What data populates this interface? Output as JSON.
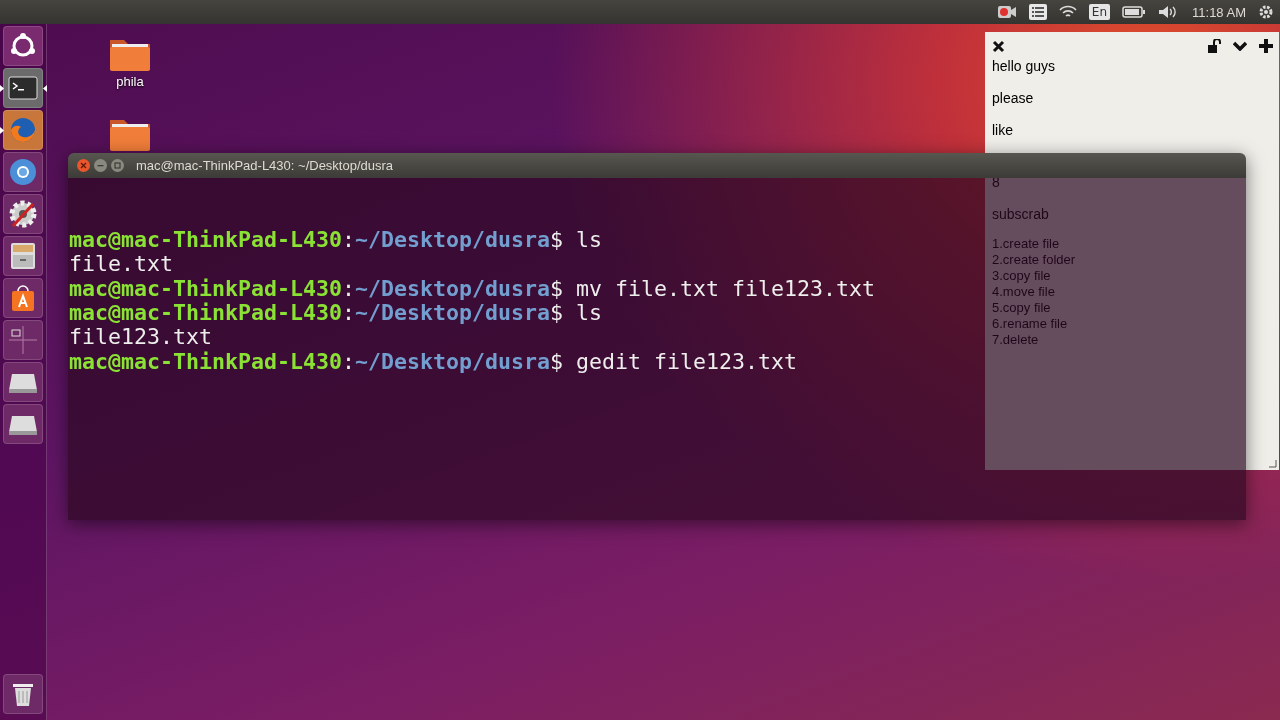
{
  "top_panel": {
    "indicators": [
      {
        "kind": "recorder"
      },
      {
        "kind": "menu"
      },
      {
        "kind": "wifi"
      },
      {
        "kind": "keyboard",
        "label": "En"
      },
      {
        "kind": "battery"
      },
      {
        "kind": "volume"
      }
    ],
    "clock": "11:18 AM"
  },
  "launcher": {
    "items": [
      {
        "kind": "dash",
        "running": false,
        "focused": false
      },
      {
        "kind": "terminal",
        "running": true,
        "focused": true
      },
      {
        "kind": "firefox",
        "running": true,
        "focused": false
      },
      {
        "kind": "chromium",
        "running": false,
        "focused": false
      },
      {
        "kind": "settings",
        "running": false,
        "focused": false
      },
      {
        "kind": "files",
        "running": false,
        "focused": false
      },
      {
        "kind": "software",
        "running": false,
        "focused": false
      },
      {
        "kind": "workspaces",
        "running": false,
        "focused": false
      },
      {
        "kind": "drive",
        "running": false,
        "focused": false
      },
      {
        "kind": "drive",
        "running": false,
        "focused": false
      }
    ],
    "trash": {
      "kind": "trash"
    }
  },
  "desktop_icons": [
    {
      "kind": "folder",
      "label": "phila"
    },
    {
      "kind": "folder"
    }
  ],
  "sticky_note": {
    "lines": [
      "hello guys",
      "please",
      "like"
    ],
    "seen_through_terminal": {
      "paragraphs": [
        "8",
        "subscrab"
      ],
      "list": [
        "1.create file",
        "2.create folder",
        "3.copy file",
        "4.move file",
        "5.copy file",
        "6.rename file",
        "7.delete"
      ]
    }
  },
  "terminal": {
    "title": "mac@mac-ThinkPad-L430: ~/Desktop/dusra",
    "lines": [
      {
        "kind": "prompt",
        "user_host": "mac@mac-ThinkPad-L430",
        "separator": ":",
        "path": "~/Desktop/dusra",
        "command": "$ ls"
      },
      {
        "kind": "output",
        "text": "file.txt"
      },
      {
        "kind": "prompt",
        "user_host": "mac@mac-ThinkPad-L430",
        "separator": ":",
        "path": "~/Desktop/dusra",
        "command": "$ mv file.txt file123.txt"
      },
      {
        "kind": "prompt",
        "user_host": "mac@mac-ThinkPad-L430",
        "separator": ":",
        "path": "~/Desktop/dusra",
        "command": "$ ls"
      },
      {
        "kind": "output",
        "text": "file123.txt"
      },
      {
        "kind": "prompt",
        "user_host": "mac@mac-ThinkPad-L430",
        "separator": ":",
        "path": "~/Desktop/dusra",
        "command": "$ gedit file123.txt"
      }
    ]
  }
}
